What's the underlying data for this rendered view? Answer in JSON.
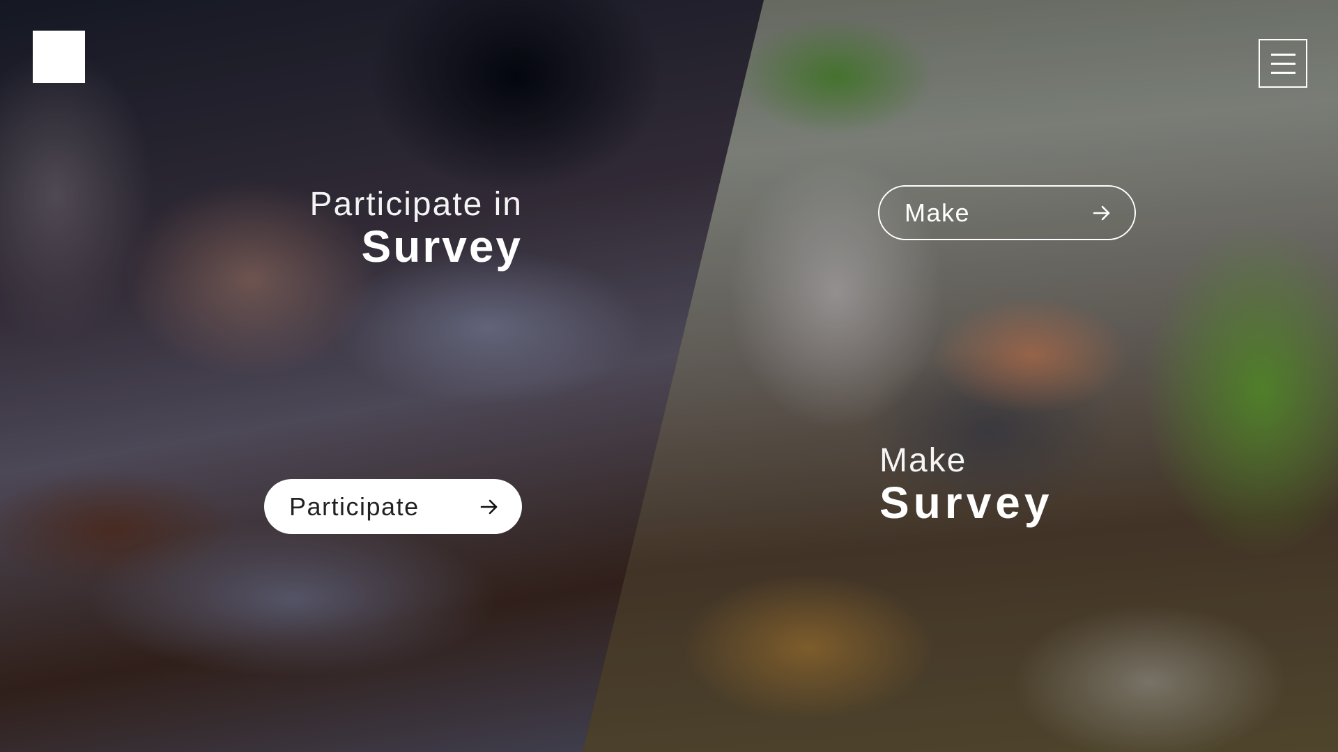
{
  "header": {
    "logo_icon": "square-logo-icon",
    "menu_icon": "hamburger-menu-icon"
  },
  "participate": {
    "heading_light": "Participate in",
    "heading_bold": "Survey",
    "button_label": "Participate",
    "button_icon": "arrow-right-icon"
  },
  "make": {
    "heading_light": "Make",
    "heading_bold": "Survey",
    "button_label": "Make",
    "button_icon": "arrow-right-icon"
  },
  "colors": {
    "text": "#ffffff",
    "button_fill": "#ffffff",
    "button_text_dark": "#222222"
  }
}
